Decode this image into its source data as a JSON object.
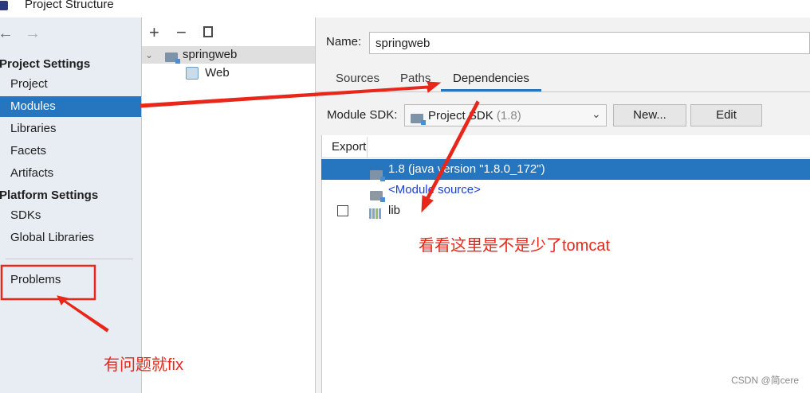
{
  "window": {
    "title": "Project Structure"
  },
  "left_panel": {
    "back_icon": "arrow-left-icon",
    "forward_icon": "arrow-right-icon",
    "project_settings": {
      "heading": "Project Settings",
      "items": [
        "Project",
        "Modules",
        "Libraries",
        "Facets",
        "Artifacts"
      ],
      "selected": "Modules"
    },
    "platform_settings": {
      "heading": "Platform Settings",
      "items": [
        "SDKs",
        "Global Libraries"
      ]
    },
    "problems_label": "Problems"
  },
  "middle_panel": {
    "toolbar": {
      "add": "+",
      "remove": "−",
      "copy_icon": "copy-icon"
    },
    "tree": {
      "module": "springweb",
      "children": [
        "Web"
      ]
    }
  },
  "right_panel": {
    "name_label": "Name:",
    "name_value": "springweb",
    "tabs": [
      "Sources",
      "Paths",
      "Dependencies"
    ],
    "active_tab": "Dependencies",
    "sdk_label": "Module SDK:",
    "sdk_value": "Project SDK",
    "sdk_version": "(1.8)",
    "new_button": "New...",
    "edit_button": "Edit",
    "table": {
      "export_header": "Export",
      "rows": [
        {
          "label": "1.8 (java version \"1.8.0_172\")",
          "selected": true
        },
        {
          "label": "<Module source>",
          "selected": false
        },
        {
          "label": "lib",
          "selected": false,
          "checkbox": false
        }
      ]
    }
  },
  "annotations": {
    "note_deps": "看看这里是不是少了tomcat",
    "note_problems": "有问题就fix",
    "color": "#e8271a"
  },
  "watermark": "CSDN @简cere"
}
